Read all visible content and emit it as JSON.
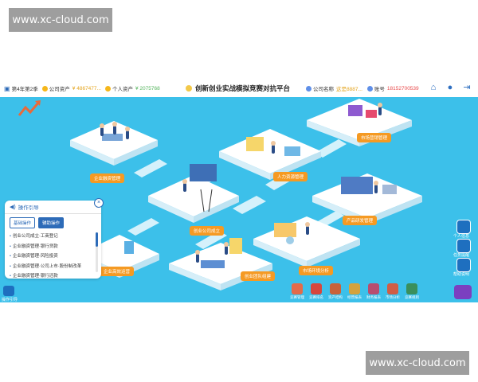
{
  "watermark": {
    "top_left": "www.xc-cloud.com",
    "bottom_right": "www.xc-cloud.com"
  },
  "topbar": {
    "period": "第4年第2季",
    "company_assets_label": "公司资产",
    "company_assets_value": "¥ 4867477...",
    "personal_assets_label": "个人资产",
    "personal_assets_value": "¥ 2075768",
    "title": "创新创业实战模拟竞赛对抗平台",
    "company_name_label": "公司名称",
    "company_name_value": "这是8887...",
    "account_label": "账号",
    "account_value": "18152700539"
  },
  "tiles": [
    {
      "label": "企业融资管理"
    },
    {
      "label": "人力资源管理"
    },
    {
      "label": "市场营销管理"
    },
    {
      "label": "产品研发管理"
    },
    {
      "label": "创业公司成立"
    },
    {
      "label": "市场环境分析"
    },
    {
      "label": "企业高效运营"
    },
    {
      "label": "创业团队组建"
    }
  ],
  "guide": {
    "title": "操作引导",
    "tabs": [
      "基础操作",
      "辅助操作"
    ],
    "items": [
      "创业公司成立·工商登记",
      "企业融资管理·银行贷款",
      "企业融资管理·风险投资",
      "企业融资管理·公司上市·股份制改革",
      "企业融资管理·银行还款"
    ]
  },
  "side_buttons": [
    "个人信息",
    "任务提醒",
    "帮助说明"
  ],
  "dock": [
    "竞赛管理",
    "竞赛排名",
    "资产结构",
    "经营报表",
    "财务报表",
    "市场分析",
    "竞赛规则"
  ],
  "bottom_left": "操作引导",
  "colors": {
    "sea": "#3cc0ea",
    "label": "#f59a23",
    "tile": "#ffffff",
    "accent": "#2d6bb8"
  }
}
